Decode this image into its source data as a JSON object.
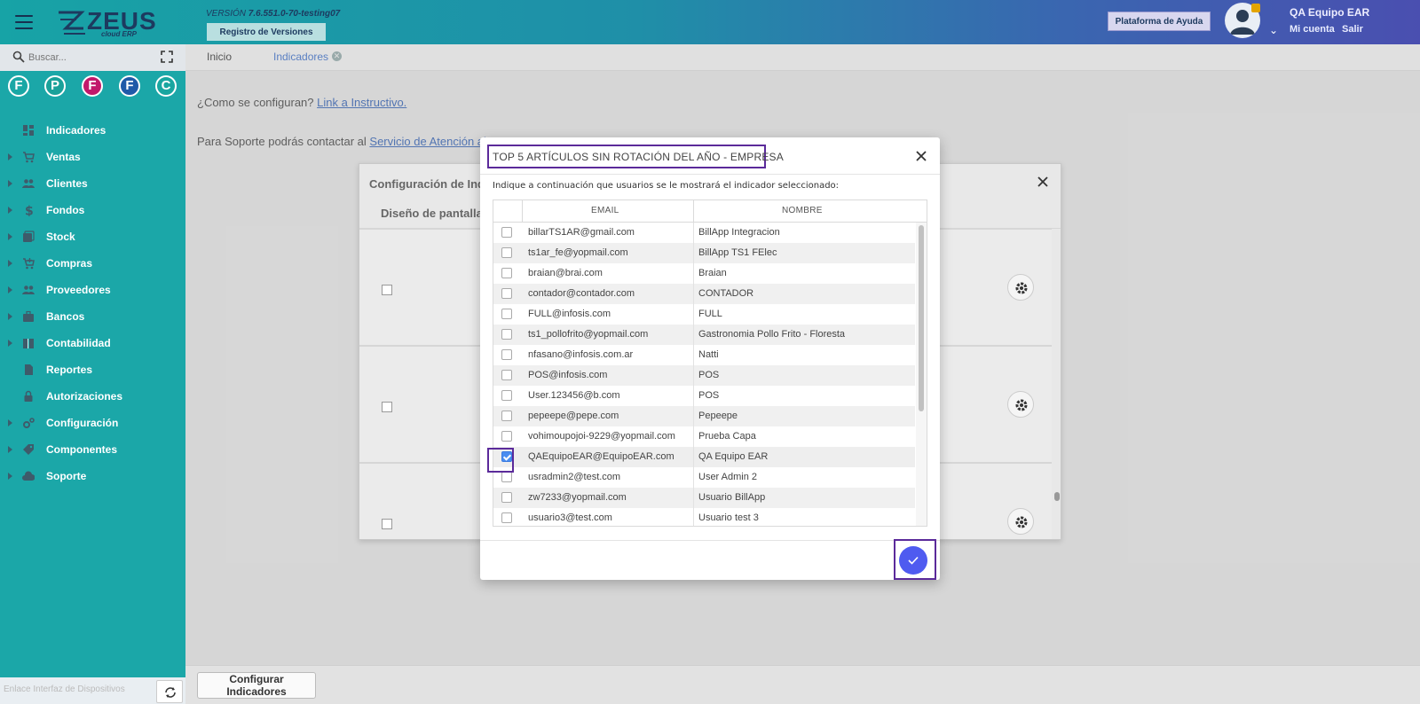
{
  "header": {
    "version_label": "VERSIÓN",
    "version_value": "7.6.551.0-70-testing07",
    "versions_button": "Registro de Versiones",
    "help_button": "Plataforma de Ayuda",
    "user_name": "QA Equipo EAR",
    "my_account": "Mi cuenta",
    "exit": "Salir",
    "logo_text": "ZEUS",
    "logo_sub": "cloud ERP"
  },
  "sidebar": {
    "search_placeholder": "Buscar...",
    "favorites": [
      {
        "letter": "F",
        "color": "#1aa7a5"
      },
      {
        "letter": "P",
        "color": "#1aa19a"
      },
      {
        "letter": "F",
        "color": "#c2186b"
      },
      {
        "letter": "F",
        "color": "#1f5aa8"
      },
      {
        "letter": "C",
        "color": "#19a6a0"
      }
    ],
    "items": [
      {
        "label": "Indicadores",
        "caret": false,
        "icon": "dashboard-icon"
      },
      {
        "label": "Ventas",
        "caret": true,
        "icon": "cart-icon"
      },
      {
        "label": "Clientes",
        "caret": true,
        "icon": "people-icon"
      },
      {
        "label": "Fondos",
        "caret": true,
        "icon": "dollar-icon"
      },
      {
        "label": "Stock",
        "caret": true,
        "icon": "stack-icon"
      },
      {
        "label": "Compras",
        "caret": true,
        "icon": "cart-plus-icon"
      },
      {
        "label": "Proveedores",
        "caret": true,
        "icon": "people-icon"
      },
      {
        "label": "Bancos",
        "caret": true,
        "icon": "briefcase-icon"
      },
      {
        "label": "Contabilidad",
        "caret": true,
        "icon": "book-icon"
      },
      {
        "label": "Reportes",
        "caret": false,
        "icon": "document-icon"
      },
      {
        "label": "Autorizaciones",
        "caret": false,
        "icon": "lock-icon"
      },
      {
        "label": "Configuración",
        "caret": true,
        "icon": "gears-icon"
      },
      {
        "label": "Componentes",
        "caret": true,
        "icon": "tag-icon"
      },
      {
        "label": "Soporte",
        "caret": true,
        "icon": "cloud-icon"
      }
    ],
    "footer_text": "Enlace Interfaz de Dispositivos"
  },
  "tabs": [
    {
      "label": "Inicio"
    },
    {
      "label": "Indicadores"
    }
  ],
  "main": {
    "question": "¿Como se configuran?",
    "question_link": "Link a Instructivo.",
    "support_text": "Para Soporte podrás contactar al",
    "support_link": "Servicio de Atención al",
    "configure_button": "Configurar Indicadores"
  },
  "back_dialog": {
    "title": "Configuración de Indic",
    "subtitle": "Diseño de pantalla"
  },
  "modal": {
    "title": "TOP 5 ARTÍCULOS SIN ROTACIÓN DEL AÑO - EMPRESA",
    "instructions": "Indique a continuación que usuarios se le mostrará el indicador seleccionado:",
    "col_email": "EMAIL",
    "col_name": "NOMBRE",
    "rows": [
      {
        "email": "billarTS1AR@gmail.com",
        "name": "BillApp Integracion",
        "checked": false
      },
      {
        "email": "ts1ar_fe@yopmail.com",
        "name": "BillApp TS1 FElec",
        "checked": false
      },
      {
        "email": "braian@brai.com",
        "name": "Braian",
        "checked": false
      },
      {
        "email": "contador@contador.com",
        "name": "CONTADOR",
        "checked": false
      },
      {
        "email": "FULL@infosis.com",
        "name": "FULL",
        "checked": false
      },
      {
        "email": "ts1_pollofrito@yopmail.com",
        "name": "Gastronomia Pollo Frito - Floresta",
        "checked": false
      },
      {
        "email": "nfasano@infosis.com.ar",
        "name": "Natti",
        "checked": false
      },
      {
        "email": "POS@infosis.com",
        "name": "POS",
        "checked": false
      },
      {
        "email": "User.123456@b.com",
        "name": "POS",
        "checked": false
      },
      {
        "email": "pepeepe@pepe.com",
        "name": "Pepeepe",
        "checked": false
      },
      {
        "email": "vohimoupojoi-9229@yopmail.com",
        "name": "Prueba Capa",
        "checked": false
      },
      {
        "email": "QAEquipoEAR@EquipoEAR.com",
        "name": "QA Equipo EAR",
        "checked": true
      },
      {
        "email": "usradmin2@test.com",
        "name": "User Admin 2",
        "checked": false
      },
      {
        "email": "zw7233@yopmail.com",
        "name": "Usuario BillApp",
        "checked": false
      },
      {
        "email": "usuario3@test.com",
        "name": "Usuario test 3",
        "checked": false
      }
    ],
    "confirm_color": "#4f5bf0"
  }
}
